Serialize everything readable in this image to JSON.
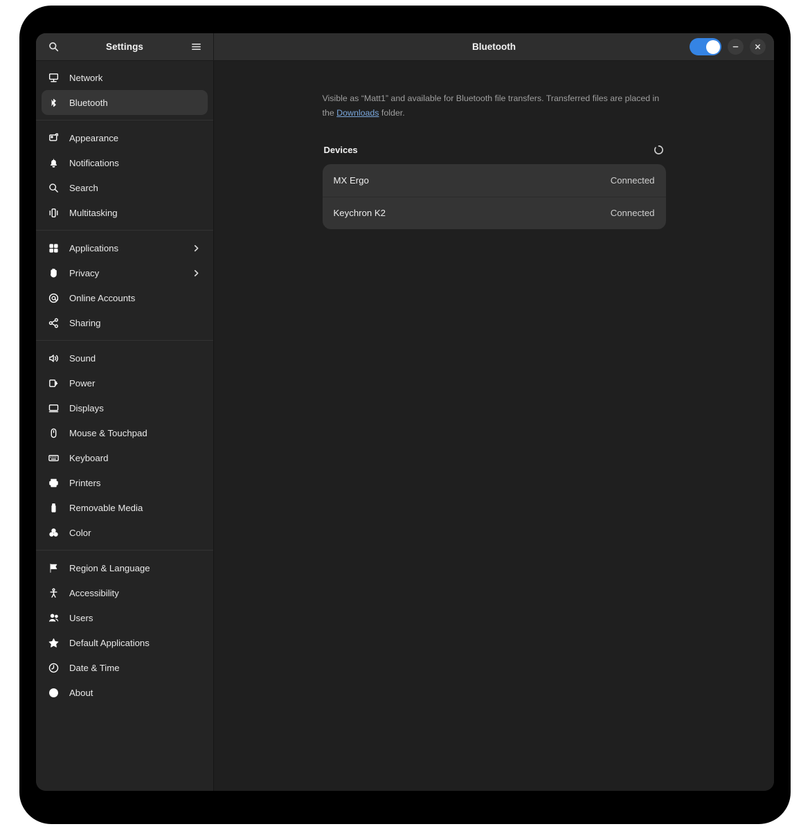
{
  "window": {
    "sidebar_header": {
      "title": "Settings",
      "search_icon": "search-icon",
      "menu_icon": "hamburger-menu-icon"
    },
    "content_header": {
      "title": "Bluetooth",
      "toggle": {
        "name": "bluetooth-power-toggle",
        "state": "on",
        "accent_color": "#3584e4"
      },
      "minimize_label": "–",
      "close_label": "×"
    }
  },
  "sidebar": {
    "groups": [
      {
        "items": [
          {
            "label": "Network",
            "icon": "network-icon",
            "selected": false,
            "has_chevron": false
          },
          {
            "label": "Bluetooth",
            "icon": "bluetooth-icon",
            "selected": true,
            "has_chevron": false
          }
        ]
      },
      {
        "items": [
          {
            "label": "Appearance",
            "icon": "appearance-icon",
            "selected": false,
            "has_chevron": false
          },
          {
            "label": "Notifications",
            "icon": "bell-icon",
            "selected": false,
            "has_chevron": false
          },
          {
            "label": "Search",
            "icon": "search-icon",
            "selected": false,
            "has_chevron": false
          },
          {
            "label": "Multitasking",
            "icon": "multitasking-icon",
            "selected": false,
            "has_chevron": false
          }
        ]
      },
      {
        "items": [
          {
            "label": "Applications",
            "icon": "applications-grid-icon",
            "selected": false,
            "has_chevron": true
          },
          {
            "label": "Privacy",
            "icon": "hand-privacy-icon",
            "selected": false,
            "has_chevron": true
          },
          {
            "label": "Online Accounts",
            "icon": "at-sign-icon",
            "selected": false,
            "has_chevron": false
          },
          {
            "label": "Sharing",
            "icon": "share-nodes-icon",
            "selected": false,
            "has_chevron": false
          }
        ]
      },
      {
        "items": [
          {
            "label": "Sound",
            "icon": "speaker-icon",
            "selected": false,
            "has_chevron": false
          },
          {
            "label": "Power",
            "icon": "battery-power-icon",
            "selected": false,
            "has_chevron": false
          },
          {
            "label": "Displays",
            "icon": "display-monitor-icon",
            "selected": false,
            "has_chevron": false
          },
          {
            "label": "Mouse & Touchpad",
            "icon": "mouse-icon",
            "selected": false,
            "has_chevron": false
          },
          {
            "label": "Keyboard",
            "icon": "keyboard-icon",
            "selected": false,
            "has_chevron": false
          },
          {
            "label": "Printers",
            "icon": "printer-icon",
            "selected": false,
            "has_chevron": false
          },
          {
            "label": "Removable Media",
            "icon": "usb-drive-icon",
            "selected": false,
            "has_chevron": false
          },
          {
            "label": "Color",
            "icon": "color-circles-icon",
            "selected": false,
            "has_chevron": false
          }
        ]
      },
      {
        "items": [
          {
            "label": "Region & Language",
            "icon": "flag-icon",
            "selected": false,
            "has_chevron": false
          },
          {
            "label": "Accessibility",
            "icon": "accessibility-person-icon",
            "selected": false,
            "has_chevron": false
          },
          {
            "label": "Users",
            "icon": "users-icon",
            "selected": false,
            "has_chevron": false
          },
          {
            "label": "Default Applications",
            "icon": "star-icon",
            "selected": false,
            "has_chevron": false
          },
          {
            "label": "Date & Time",
            "icon": "clock-icon",
            "selected": false,
            "has_chevron": false
          },
          {
            "label": "About",
            "icon": "info-circle-icon",
            "selected": false,
            "has_chevron": false
          }
        ]
      }
    ]
  },
  "main": {
    "visibility": {
      "text_before_link": "Visible as “Matt1” and available for Bluetooth file transfers. Transferred files are placed in the ",
      "link_label": "Downloads",
      "text_after_link": " folder."
    },
    "devices_section": {
      "heading": "Devices",
      "spinner": "loading-spinner-icon",
      "rows": [
        {
          "name": "MX Ergo",
          "status": "Connected"
        },
        {
          "name": "Keychron K2",
          "status": "Connected"
        }
      ]
    }
  }
}
